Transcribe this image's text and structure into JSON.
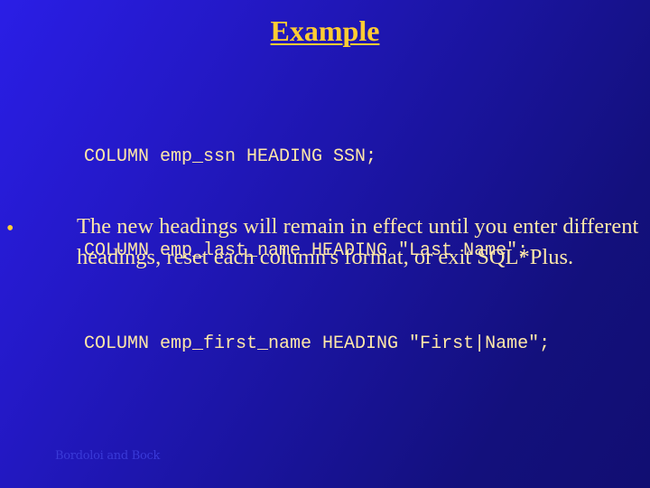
{
  "slide": {
    "title": "Example",
    "code_lines": [
      "COLUMN emp_ssn HEADING SSN;",
      "COLUMN emp_last_name HEADING \"Last Name\";",
      "COLUMN emp_first_name HEADING \"First|Name\";"
    ],
    "bullets": [
      {
        "marker": "•",
        "text": "The new headings will remain in effect until you enter different headings, reset each column's format, or exit SQL*Plus."
      }
    ],
    "footer": "Bordoloi and Bock"
  },
  "colors": {
    "background_light": "#2a1ee6",
    "background_dark": "#110e72",
    "title": "#ffcc33",
    "body_text": "#ffe8a8",
    "footer_text": "#3a3ad8"
  }
}
